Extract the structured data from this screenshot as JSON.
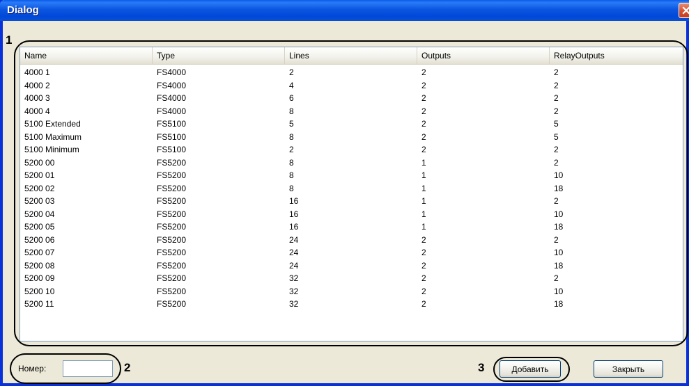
{
  "window": {
    "title": "Dialog",
    "close_icon": "close-x-icon",
    "colors": {
      "titlebar": "#0054E3",
      "frame": "#0831D9",
      "face": "#ECE9D8",
      "close": "#D85030"
    }
  },
  "annotations": {
    "one": "1",
    "two": "2",
    "three": "3"
  },
  "list": {
    "columns": [
      "Name",
      "Type",
      "Lines",
      "Outputs",
      "RelayOutputs"
    ],
    "rows": [
      [
        "4000 1",
        "FS4000",
        "2",
        "2",
        "2"
      ],
      [
        "4000 2",
        "FS4000",
        "4",
        "2",
        "2"
      ],
      [
        "4000 3",
        "FS4000",
        "6",
        "2",
        "2"
      ],
      [
        "4000 4",
        "FS4000",
        "8",
        "2",
        "2"
      ],
      [
        "5100 Extended",
        "FS5100",
        "5",
        "2",
        "5"
      ],
      [
        "5100 Maximum",
        "FS5100",
        "8",
        "2",
        "5"
      ],
      [
        "5100 Minimum",
        "FS5100",
        "2",
        "2",
        "2"
      ],
      [
        "5200 00",
        "FS5200",
        "8",
        "1",
        "2"
      ],
      [
        "5200 01",
        "FS5200",
        "8",
        "1",
        "10"
      ],
      [
        "5200 02",
        "FS5200",
        "8",
        "1",
        "18"
      ],
      [
        "5200 03",
        "FS5200",
        "16",
        "1",
        "2"
      ],
      [
        "5200 04",
        "FS5200",
        "16",
        "1",
        "10"
      ],
      [
        "5200 05",
        "FS5200",
        "16",
        "1",
        "18"
      ],
      [
        "5200 06",
        "FS5200",
        "24",
        "2",
        "2"
      ],
      [
        "5200 07",
        "FS5200",
        "24",
        "2",
        "10"
      ],
      [
        "5200 08",
        "FS5200",
        "24",
        "2",
        "18"
      ],
      [
        "5200 09",
        "FS5200",
        "32",
        "2",
        "2"
      ],
      [
        "5200 10",
        "FS5200",
        "32",
        "2",
        "10"
      ],
      [
        "5200 11",
        "FS5200",
        "32",
        "2",
        "18"
      ]
    ]
  },
  "footer": {
    "number_label": "Номер:",
    "number_value": "",
    "add_label": "Добавить",
    "close_label": "Закрыть"
  }
}
